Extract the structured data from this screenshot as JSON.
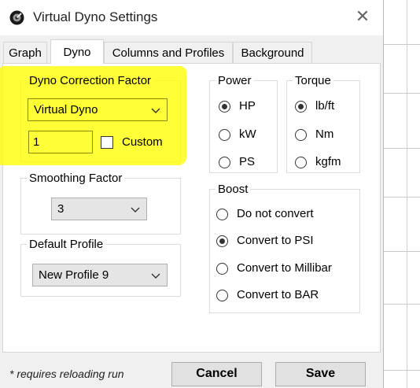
{
  "window": {
    "title": "Virtual Dyno Settings",
    "close_glyph": "✕"
  },
  "tabs": [
    {
      "label": "Graph",
      "active": false
    },
    {
      "label": "Dyno",
      "active": true
    },
    {
      "label": "Columns and Profiles",
      "active": false
    },
    {
      "label": "Background",
      "active": false
    }
  ],
  "dyno_correction": {
    "legend": "Dyno Correction Factor",
    "selected": "Virtual Dyno",
    "value": "1",
    "custom_label": "Custom",
    "custom_checked": false
  },
  "smoothing": {
    "legend": "Smoothing Factor",
    "selected": "3"
  },
  "default_profile": {
    "legend": "Default Profile",
    "selected": "New Profile 9"
  },
  "power": {
    "legend": "Power",
    "options": [
      "HP",
      "kW",
      "PS"
    ],
    "selected": "HP"
  },
  "torque": {
    "legend": "Torque",
    "options": [
      "lb/ft",
      "Nm",
      "kgfm"
    ],
    "selected": "lb/ft"
  },
  "boost": {
    "legend": "Boost",
    "options": [
      "Do not convert",
      "Convert to PSI",
      "Convert to Millibar",
      "Convert to BAR"
    ],
    "selected": "Convert to PSI"
  },
  "footer": {
    "note": "* requires reloading run",
    "cancel_label": "Cancel",
    "save_label": "Save"
  },
  "colors": {
    "highlight": "#ffff00",
    "dialog_bg": "#f0f0f0",
    "button_bg": "#e1e1e1"
  },
  "icons": {
    "app": "app-logo-icon",
    "close": "close-icon",
    "dropdown": "chevron-down-icon"
  }
}
